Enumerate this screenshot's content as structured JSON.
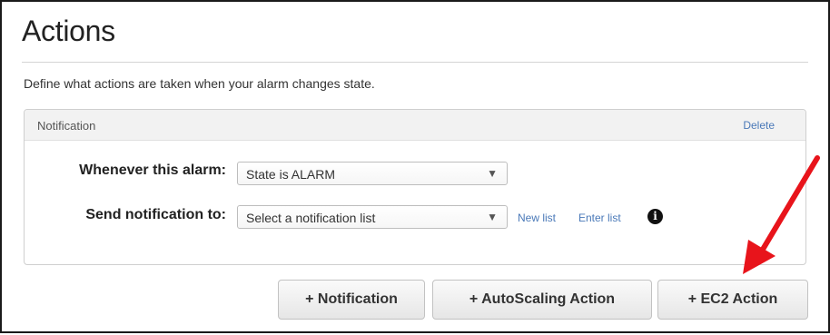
{
  "section": {
    "title": "Actions",
    "description": "Define what actions are taken when your alarm changes state."
  },
  "notification_panel": {
    "title": "Notification",
    "delete_label": "Delete",
    "alarm_label": "Whenever this alarm:",
    "alarm_value": "State is ALARM",
    "send_label": "Send notification to:",
    "send_value": "Select a notification list",
    "new_list_label": "New list",
    "enter_list_label": "Enter list",
    "info_icon": "info-icon"
  },
  "buttons": {
    "notification": "+ Notification",
    "autoscaling": "+ AutoScaling Action",
    "ec2": "+ EC2 Action"
  },
  "icons": {
    "dropdown": "▼"
  },
  "colors": {
    "link": "#4a79b8",
    "annotation_arrow": "#e8141b"
  }
}
